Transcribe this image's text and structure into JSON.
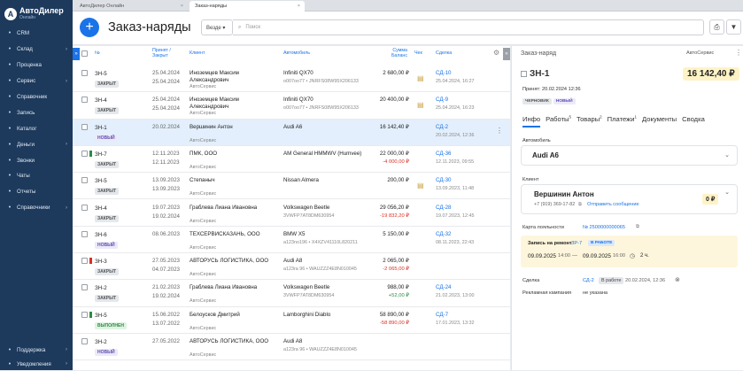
{
  "app": {
    "brand": "АвтоДилер",
    "brand_sub": "Онлайн"
  },
  "colors": {
    "sidebar": "#1d3a5c",
    "accent": "#1a73e8",
    "negative": "#d93025",
    "positive": "#2e8b45",
    "warning": "#f59e0b"
  },
  "sidebar": {
    "items": [
      {
        "label": "CRM",
        "icon": "crm-icon",
        "arrow": false
      },
      {
        "label": "Склад",
        "icon": "warehouse-icon",
        "arrow": true
      },
      {
        "label": "Проценка",
        "icon": "search-icon",
        "arrow": false
      },
      {
        "label": "Сервис",
        "icon": "service-icon",
        "arrow": true
      },
      {
        "label": "Справочник",
        "icon": "book-icon",
        "arrow": false
      },
      {
        "label": "Запись",
        "icon": "calendar-icon",
        "arrow": false
      },
      {
        "label": "Каталог",
        "icon": "catalog-icon",
        "arrow": false
      },
      {
        "label": "Деньги",
        "icon": "money-icon",
        "arrow": true
      },
      {
        "label": "Звонки",
        "icon": "phone-icon",
        "arrow": false
      },
      {
        "label": "Чаты",
        "icon": "chat-icon",
        "arrow": false
      },
      {
        "label": "Отчеты",
        "icon": "report-icon",
        "arrow": false
      },
      {
        "label": "Справочники",
        "icon": "list-icon",
        "arrow": true
      }
    ],
    "bottom": [
      {
        "label": "Поддержка",
        "icon": "support-icon"
      },
      {
        "label": "Уведомления",
        "icon": "bell-icon"
      }
    ]
  },
  "tabs": [
    {
      "label": "АвтоДилер Онлайн"
    },
    {
      "label": "Заказ-наряды"
    }
  ],
  "header": {
    "title": "Заказ-наряды",
    "scope": "Везде",
    "search_placeholder": "Поиск"
  },
  "table": {
    "headers": {
      "num": "№",
      "created": "Принят / Закрыт",
      "client": "Клиент",
      "car": "Автомобиль",
      "sum": "Сумма Баланс",
      "check": "Чек",
      "deal": "Сделка"
    },
    "rows": [
      {
        "num": "ЗН-5",
        "status": "ЗАКРЫТ",
        "st": "closed",
        "flag": "",
        "d1": "25.04.2024",
        "d2": "25.04.2024",
        "client": "Иноземцев Максим Александрович",
        "client2": "АвтоСервис",
        "car": "Infiniti QX70",
        "car2": "o007oo77 • JNRFS08W95X206133",
        "s1": "2 680,00 ₽",
        "s2": "",
        "s2c": "",
        "check": true,
        "deal": "СД-10",
        "deal_date": "25.04.2024, 16:27"
      },
      {
        "num": "ЗН-4",
        "status": "ЗАКРЫТ",
        "st": "closed",
        "flag": "",
        "d1": "25.04.2024",
        "d2": "25.04.2024",
        "client": "Иноземцев Максим Александрович",
        "client2": "АвтоСервис",
        "car": "Infiniti QX70",
        "car2": "o007oo77 • JNRFS08W95X206133",
        "s1": "20 400,00 ₽",
        "s2": "",
        "s2c": "",
        "check": true,
        "deal": "СД-9",
        "deal_date": "25.04.2024, 16:23"
      },
      {
        "num": "ЗН-1",
        "status": "НОВЫЙ",
        "st": "new",
        "flag": "",
        "d1": "20.02.2024",
        "d2": "",
        "client": "Вершинин Антон",
        "client2": "АвтоСервис",
        "car": "Audi A6",
        "car2": "",
        "s1": "16 142,40 ₽",
        "s2": "",
        "s2c": "",
        "check": false,
        "deal": "СД-2",
        "deal_date": "20.02.2024, 12:36"
      },
      {
        "num": "ЗН-7",
        "status": "ЗАКРЫТ",
        "st": "closed",
        "flag": "green",
        "d1": "12.11.2023",
        "d2": "12.11.2023",
        "client": "ПМК, ООО",
        "client2": "АвтоСервис",
        "car": "AM General HMMWV (Humvee)",
        "car2": "",
        "s1": "22 000,00 ₽",
        "s2": "-4 000,00 ₽",
        "s2c": "neg",
        "check": false,
        "deal": "СД-36",
        "deal_date": "12.11.2023, 09:55"
      },
      {
        "num": "ЗН-5",
        "status": "ЗАКРЫТ",
        "st": "closed",
        "flag": "",
        "d1": "13.09.2023",
        "d2": "13.09.2023",
        "client": "Степаныч",
        "client2": "АвтоСервис",
        "car": "Nissan Almera",
        "car2": "",
        "s1": "200,00 ₽",
        "s2": "",
        "s2c": "",
        "check": true,
        "deal": "СД-30",
        "deal_date": "13.09.2023, 11:48"
      },
      {
        "num": "ЗН-4",
        "status": "ЗАКРЫТ",
        "st": "closed",
        "flag": "",
        "d1": "19.07.2023",
        "d2": "19.02.2024",
        "client": "Граблева Лиана Ивановна",
        "client2": "АвтоСервис",
        "car": "Volkswagen Beetle",
        "car2": "3VWFP7AT8DM630954",
        "s1": "29 056,20 ₽",
        "s2": "-19 832,20 ₽",
        "s2c": "neg",
        "check": false,
        "deal": "СД-28",
        "deal_date": "19.07.2023, 12:45"
      },
      {
        "num": "ЗН-6",
        "status": "НОВЫЙ",
        "st": "new",
        "flag": "",
        "d1": "08.06.2023",
        "d2": "",
        "client": "ТЕХСЕРВИСКАЗАНЬ, ООО",
        "client2": "АвтоСервис",
        "car": "BMW X5",
        "car2": "a123no196 • X4XZV41110L820211",
        "s1": "5 150,00 ₽",
        "s2": "",
        "s2c": "",
        "check": false,
        "deal": "СД-32",
        "deal_date": "08.11.2023, 22:43"
      },
      {
        "num": "ЗН-3",
        "status": "ЗАКРЫТ",
        "st": "closed",
        "flag": "red",
        "d1": "27.05.2023",
        "d2": "04.07.2023",
        "client": "АВТОРУСЬ ЛОГИСТИКА, ООО",
        "client2": "АвтоСервис",
        "car": "Audi A8",
        "car2": "a123ra 96 • WAUZZZ4E8N010045",
        "s1": "2 065,00 ₽",
        "s2": "-2 065,00 ₽",
        "s2c": "neg",
        "check": false,
        "deal": "",
        "deal_date": ""
      },
      {
        "num": "ЗН-2",
        "status": "ЗАКРЫТ",
        "st": "closed",
        "flag": "",
        "d1": "21.02.2023",
        "d2": "19.02.2024",
        "client": "Граблева Лиана Ивановна",
        "client2": "АвтоСервис",
        "car": "Volkswagen Beetle",
        "car2": "3VWFP7AT8DM630954",
        "s1": "988,00 ₽",
        "s2": "+52,00 ₽",
        "s2c": "pos",
        "check": false,
        "deal": "СД-24",
        "deal_date": "21.02.2023, 13:00"
      },
      {
        "num": "ЗН-5",
        "status": "ВЫПОЛНЕН",
        "st": "done",
        "flag": "green",
        "d1": "15.06.2022",
        "d2": "13.07.2022",
        "client": "Белоусков Дмитрий",
        "client2": "АвтоСервис",
        "car": "Lamborghini Diablo",
        "car2": "",
        "s1": "58 890,00 ₽",
        "s2": "-58 890,00 ₽",
        "s2c": "neg",
        "check": false,
        "deal": "СД-7",
        "deal_date": "17.01.2023, 13:32"
      },
      {
        "num": "ЗН-2",
        "status": "НОВЫЙ",
        "st": "new",
        "flag": "",
        "d1": "27.05.2022",
        "d2": "",
        "client": "АВТОРУСЬ ЛОГИСТИКА, ООО",
        "client2": "АвтоСервис",
        "car": "Audi A8",
        "car2": "a123ra 96 • WAUZZZ4E8N010045",
        "s1": "",
        "s2": "",
        "s2c": "",
        "check": false,
        "deal": "",
        "deal_date": ""
      }
    ]
  },
  "panel": {
    "title": "Заказ-наряд",
    "org": "АвтоСервис",
    "number": "ЗН-1",
    "total": "16 142,40 ₽",
    "accepted": "Принят: 20.02.2024 12:36",
    "tags": [
      "ЧЕРНОВИК",
      "НОВЫЙ"
    ],
    "tabs": [
      {
        "label": "Инфо",
        "sup": ""
      },
      {
        "label": "Работы",
        "sup": "5"
      },
      {
        "label": "Товары",
        "sup": "2"
      },
      {
        "label": "Платежи",
        "sup": "1"
      },
      {
        "label": "Документы",
        "sup": ""
      },
      {
        "label": "Сводка",
        "sup": ""
      }
    ],
    "car_label": "Автомобиль",
    "car": "Audi A6",
    "client_label": "Клиент",
    "client_name": "Вершинин Антон",
    "client_phone": "+7 (919) 369-17-82",
    "send_msg": "Отправить сообщение",
    "client_balance": "0 ₽",
    "loyalty_label": "Карта лояльности",
    "loyalty_num": "№ 2500000000065",
    "repair_label": "Запись на ремонт",
    "repair_num": "ЗР-7",
    "repair_status": "В РАБОТЕ",
    "r_d1": "09.09.2025",
    "r_t1": "14:00",
    "r_d2": "09.09.2025",
    "r_t2": "16:00",
    "r_dur": "2 ч.",
    "deal_label": "Сделка",
    "deal_num": "СД-2",
    "deal_status": "В работе",
    "deal_date": "20.02.2024, 12:36",
    "ad_label": "Рекламная кампания",
    "ad_value": "не указана"
  }
}
